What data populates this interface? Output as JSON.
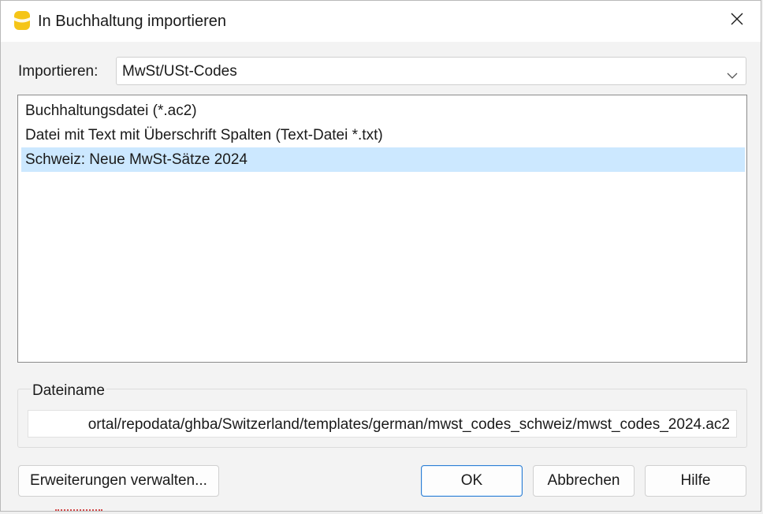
{
  "window": {
    "title": "In Buchhaltung importieren",
    "app_icon": "banana-icon",
    "close_icon": "close-icon"
  },
  "import": {
    "label": "Importieren:",
    "selected": "MwSt/USt-Codes"
  },
  "sources": [
    {
      "label": "Buchhaltungsdatei (*.ac2)",
      "selected": false
    },
    {
      "label": "Datei mit Text mit Überschrift Spalten (Text-Datei *.txt)",
      "selected": false
    },
    {
      "label": "Schweiz: Neue MwSt-Sätze 2024",
      "selected": true
    }
  ],
  "file": {
    "legend": "Dateiname",
    "value": "ortal/repodata/ghba/Switzerland/templates/german/mwst_codes_schweiz/mwst_codes_2024.ac2"
  },
  "buttons": {
    "extensions": "Erweiterungen verwalten...",
    "ok": "OK",
    "cancel": "Abbrechen",
    "help": "Hilfe"
  },
  "colors": {
    "selection": "#cce8ff",
    "accent": "#2f7fd3",
    "icon_yellow": "#f5c518"
  }
}
